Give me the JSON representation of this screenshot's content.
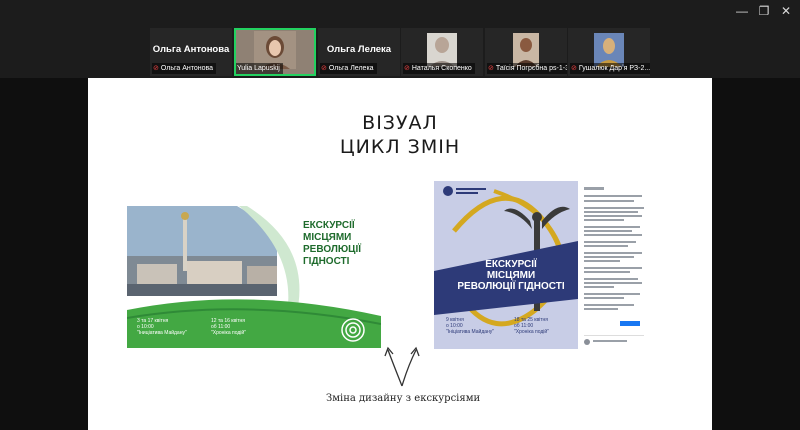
{
  "window_controls": {
    "minimize": "—",
    "maximize": "❐",
    "close": "✕"
  },
  "participants": [
    {
      "name": "Ольга Антонова",
      "display": "Ольга Антонова",
      "muted": true,
      "video": false,
      "active": false
    },
    {
      "name": "Yulia Lapuskij",
      "display": "",
      "muted": false,
      "video": true,
      "active": true
    },
    {
      "name": "Ольга Лелека",
      "display": "Ольга Лелека",
      "muted": true,
      "video": false,
      "active": false
    },
    {
      "name": "Наталья Скопенко",
      "display": "",
      "muted": true,
      "video": true,
      "active": false
    },
    {
      "name": "Таїсія Погрєбна ps-1-3",
      "display": "",
      "muted": true,
      "video": true,
      "active": false
    },
    {
      "name": "Гушалюк Дарʼя РЗ-2...",
      "display": "",
      "muted": true,
      "video": true,
      "active": false
    }
  ],
  "slide": {
    "title_line1": "ВІЗУАЛ",
    "title_line2": "ЦИКЛ ЗМІН",
    "caption": "Зміна дизайну з екскурсіями"
  },
  "poster_old": {
    "title_lines": [
      "ЕКСКУРСІЇ",
      "МІСЦЯМИ",
      "РЕВОЛЮЦІЇ",
      "ГІДНОСТІ"
    ],
    "date1": "3 та 17 квітня",
    "time1": "о 10:00",
    "route1": "\"Іниціатива Майдану\"",
    "date2": "12 та 16 квітня",
    "time2": "об 11:00",
    "route2": "\"Хроніка подій\"",
    "colors": {
      "green": "#43a843",
      "dark": "#1e6b2c"
    }
  },
  "poster_new": {
    "title_lines": [
      "ЕКСКУРСІЇ",
      "МІСЦЯМИ",
      "РЕВОЛЮЦІЇ ГІДНОСТІ"
    ],
    "date1": "9 квітня",
    "time1": "о 10:00",
    "route1": "\"Ініціатива Майдану\"",
    "date2": "18 та 25 квітня",
    "time2": "об 11:00",
    "route2": "\"Хроніка подій\"",
    "colors": {
      "navy": "#2d3a78",
      "gold": "#d4a820"
    }
  }
}
